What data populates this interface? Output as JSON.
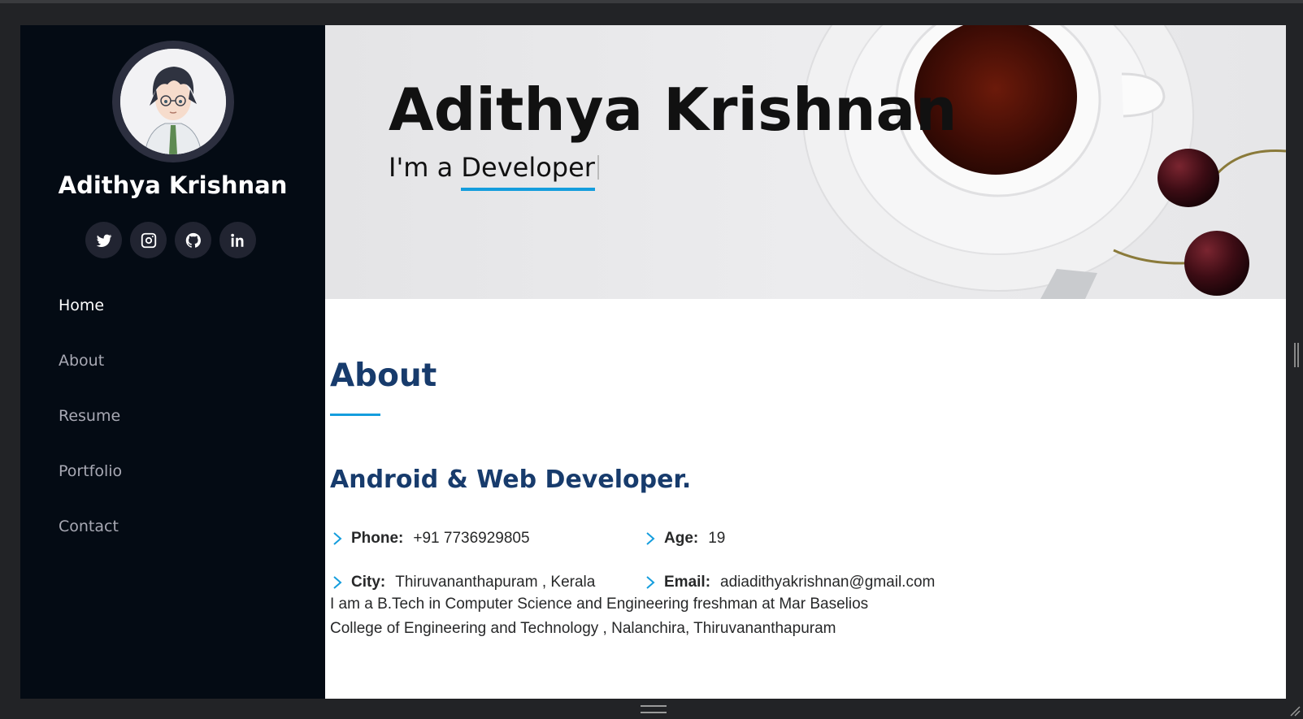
{
  "sidebar": {
    "profile_name": "Adithya Krishnan",
    "social": [
      {
        "name": "twitter-icon"
      },
      {
        "name": "instagram-icon"
      },
      {
        "name": "github-icon"
      },
      {
        "name": "linkedin-icon"
      }
    ],
    "nav": [
      {
        "label": "Home",
        "active": true
      },
      {
        "label": "About"
      },
      {
        "label": "Resume"
      },
      {
        "label": "Portfolio"
      },
      {
        "label": "Contact"
      }
    ]
  },
  "hero": {
    "name": "Adithya Krishnan",
    "sub_prefix": "I'm a ",
    "typed_word": "Developer"
  },
  "about": {
    "title": "About",
    "role": "Android & Web Developer.",
    "phone_label": "Phone:",
    "phone_value": "+91 7736929805",
    "age_label": "Age:",
    "age_value": "19",
    "city_label": "City:",
    "city_value": "Thiruvananthapuram , Kerala",
    "email_label": "Email:",
    "email_value": "adiadithyakrishnan@gmail.com",
    "bio_line1": "I am a B.Tech in Computer Science and Engineering freshman at Mar Baselios",
    "bio_line2": "College of Engineering and Technology , Nalanchira, Thiruvananthapuram"
  },
  "colors": {
    "sidebar_bg": "#040b14",
    "accent": "#149ddd",
    "heading": "#173b6c",
    "nav_inactive": "#a8a9b4"
  }
}
